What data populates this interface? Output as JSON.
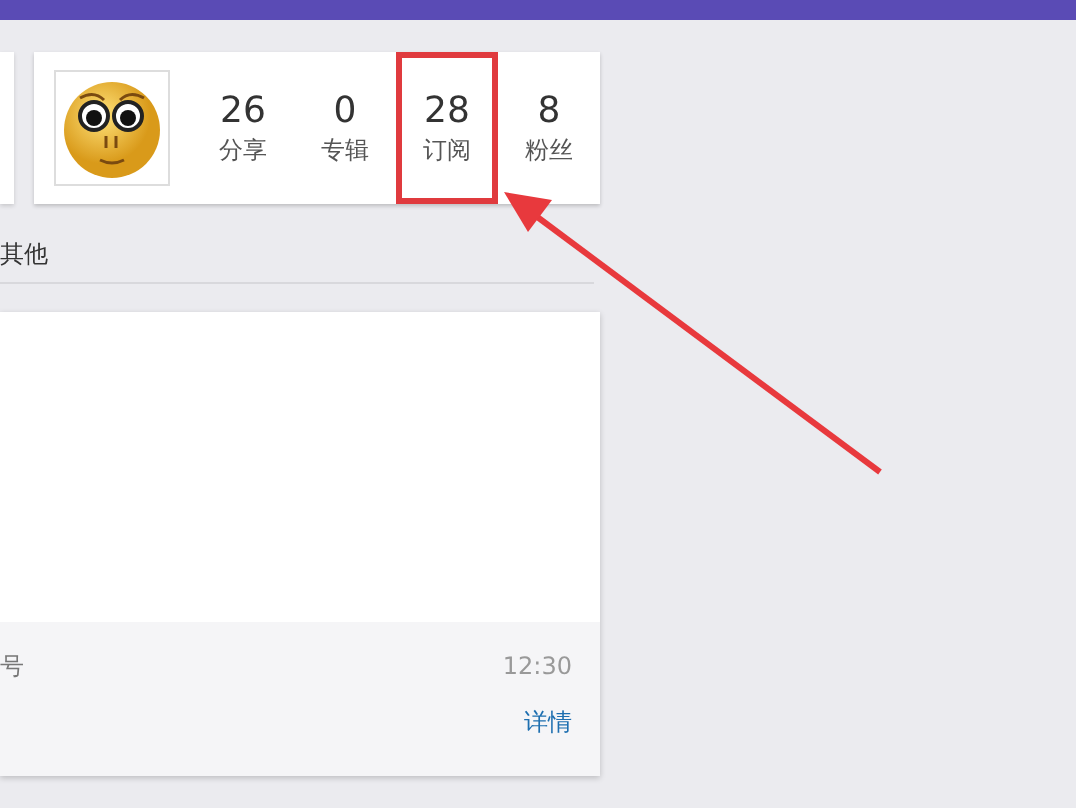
{
  "profile": {
    "stats": [
      {
        "value": "26",
        "label": "分享",
        "highlighted": false
      },
      {
        "value": "0",
        "label": "专辑",
        "highlighted": false
      },
      {
        "value": "28",
        "label": "订阅",
        "highlighted": true
      },
      {
        "value": "8",
        "label": "粉丝",
        "highlighted": false
      }
    ]
  },
  "section": {
    "title": "其他"
  },
  "post": {
    "source": "号",
    "time": "12:30",
    "link": "详情"
  }
}
